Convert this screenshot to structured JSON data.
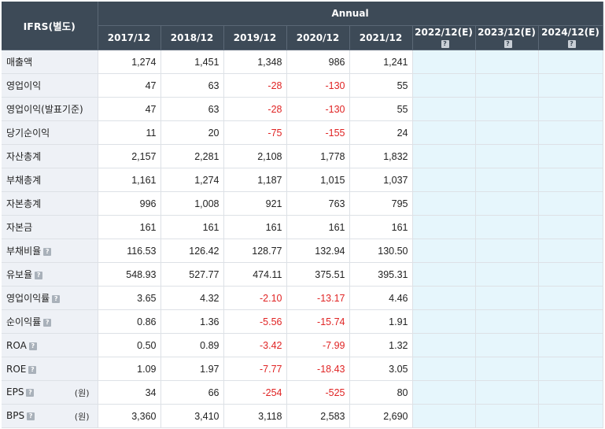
{
  "header": {
    "corner_label": "IFRS(별도)",
    "group_label": "Annual",
    "help_icon_glyph": "?",
    "periods": [
      {
        "label": "2017/12",
        "estimate": false
      },
      {
        "label": "2018/12",
        "estimate": false
      },
      {
        "label": "2019/12",
        "estimate": false
      },
      {
        "label": "2020/12",
        "estimate": false
      },
      {
        "label": "2021/12",
        "estimate": false
      },
      {
        "label": "2022/12(E)",
        "estimate": true
      },
      {
        "label": "2023/12(E)",
        "estimate": true
      },
      {
        "label": "2024/12(E)",
        "estimate": true
      }
    ]
  },
  "rows": [
    {
      "label": "매출액",
      "help": false,
      "unit": "",
      "values": [
        "1,274",
        "1,451",
        "1,348",
        "986",
        "1,241",
        "",
        "",
        ""
      ]
    },
    {
      "label": "영업이익",
      "help": false,
      "unit": "",
      "values": [
        "47",
        "63",
        "-28",
        "-130",
        "55",
        "",
        "",
        ""
      ]
    },
    {
      "label": "영업이익(발표기준)",
      "help": false,
      "unit": "",
      "values": [
        "47",
        "63",
        "-28",
        "-130",
        "55",
        "",
        "",
        ""
      ]
    },
    {
      "label": "당기순이익",
      "help": false,
      "unit": "",
      "values": [
        "11",
        "20",
        "-75",
        "-155",
        "24",
        "",
        "",
        ""
      ]
    },
    {
      "label": "자산총계",
      "help": false,
      "unit": "",
      "values": [
        "2,157",
        "2,281",
        "2,108",
        "1,778",
        "1,832",
        "",
        "",
        ""
      ]
    },
    {
      "label": "부채총계",
      "help": false,
      "unit": "",
      "values": [
        "1,161",
        "1,274",
        "1,187",
        "1,015",
        "1,037",
        "",
        "",
        ""
      ]
    },
    {
      "label": "자본총계",
      "help": false,
      "unit": "",
      "values": [
        "996",
        "1,008",
        "921",
        "763",
        "795",
        "",
        "",
        ""
      ]
    },
    {
      "label": "자본금",
      "help": false,
      "unit": "",
      "values": [
        "161",
        "161",
        "161",
        "161",
        "161",
        "",
        "",
        ""
      ]
    },
    {
      "label": "부채비율",
      "help": true,
      "unit": "",
      "values": [
        "116.53",
        "126.42",
        "128.77",
        "132.94",
        "130.50",
        "",
        "",
        ""
      ]
    },
    {
      "label": "유보율",
      "help": true,
      "unit": "",
      "values": [
        "548.93",
        "527.77",
        "474.11",
        "375.51",
        "395.31",
        "",
        "",
        ""
      ]
    },
    {
      "label": "영업이익률",
      "help": true,
      "unit": "",
      "values": [
        "3.65",
        "4.32",
        "-2.10",
        "-13.17",
        "4.46",
        "",
        "",
        ""
      ]
    },
    {
      "label": "순이익률",
      "help": true,
      "unit": "",
      "values": [
        "0.86",
        "1.36",
        "-5.56",
        "-15.74",
        "1.91",
        "",
        "",
        ""
      ]
    },
    {
      "label": "ROA",
      "help": true,
      "unit": "",
      "values": [
        "0.50",
        "0.89",
        "-3.42",
        "-7.99",
        "1.32",
        "",
        "",
        ""
      ]
    },
    {
      "label": "ROE",
      "help": true,
      "unit": "",
      "values": [
        "1.09",
        "1.97",
        "-7.77",
        "-18.43",
        "3.05",
        "",
        "",
        ""
      ]
    },
    {
      "label": "EPS",
      "help": true,
      "unit": "(원)",
      "values": [
        "34",
        "66",
        "-254",
        "-525",
        "80",
        "",
        "",
        ""
      ]
    },
    {
      "label": "BPS",
      "help": true,
      "unit": "(원)",
      "values": [
        "3,360",
        "3,410",
        "3,118",
        "2,583",
        "2,690",
        "",
        "",
        ""
      ]
    }
  ],
  "colors": {
    "header_bg": "#3d4a57",
    "label_bg": "#eef1f6",
    "estimate_bg": "#e6f6fc",
    "negative_text": "#e02424"
  }
}
